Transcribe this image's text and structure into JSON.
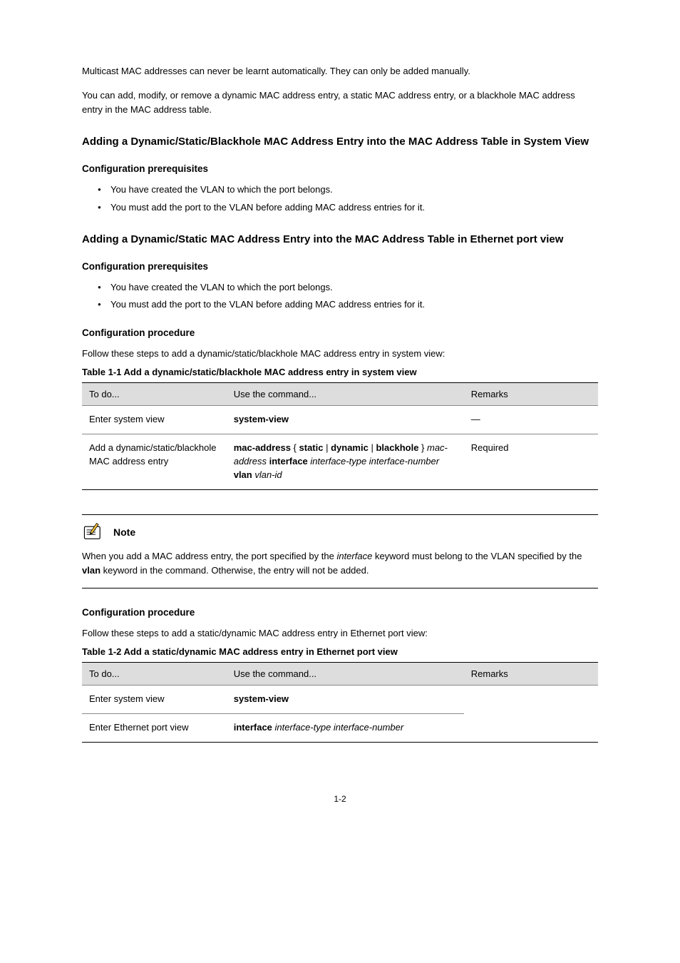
{
  "intro": {
    "p1": "Multicast MAC addresses can never be learnt automatically. They can only be added manually.",
    "p2": "You can add, modify, or remove a dynamic MAC address entry, a static MAC address entry, or a blackhole MAC address entry in the MAC address table."
  },
  "sec1": {
    "heading": "Adding a Dynamic/Static/Blackhole MAC Address Entry into the MAC Address Table in System View",
    "config_prereq_heading": "Configuration prerequisites",
    "prereq_bullets": [
      "You have created the VLAN to which the port belongs.",
      "You must add the port to the VLAN before adding MAC address entries for it."
    ],
    "config_proc_heading": "Configuration procedure",
    "config_proc_para": "Follow these steps to add a dynamic/static/blackhole MAC address entry in system view:"
  },
  "sec2": {
    "heading": "Adding a Dynamic/Static MAC Address Entry into the MAC Address Table in Ethernet port view",
    "config_prereq_heading": "Configuration prerequisites",
    "prereq_bullets": [
      "You have created the VLAN to which the port belongs.",
      "You must add the port to the VLAN before adding MAC address entries for it."
    ],
    "config_proc_heading": "Configuration procedure",
    "config_proc_para": "Follow these steps to add a static/dynamic MAC address entry in Ethernet port view:"
  },
  "table1": {
    "caption": "Table 1-1 Add a dynamic/static/blackhole MAC address entry in system view",
    "headers": {
      "todo": "To do...",
      "cmd": "Use the command...",
      "rem": "Remarks"
    },
    "rows": [
      {
        "todo": "Enter system view",
        "cmd": "system-view",
        "rem": "—"
      },
      {
        "todo": "Add a dynamic/static/blackhole MAC address entry",
        "cmd_html": "<b>mac-address</b> { <b>static</b> | <b>dynamic</b> | <b>blackhole</b> } <i>mac-address</i> <b>interface</b> <i>interface-type interface-number</i> <b>vlan</b> <i>vlan-id</i>",
        "rem": "Required"
      }
    ]
  },
  "note": {
    "label": "Note",
    "body_html": "When you add a MAC address entry, the port specified by the <i>interface</i> keyword must belong to the VLAN specified by the <b>vlan</b> keyword in the command. Otherwise, the entry will not be added."
  },
  "table2": {
    "caption": "Table 1-2 Add a static/dynamic MAC address entry in Ethernet port view",
    "headers": {
      "todo": "To do...",
      "cmd": "Use the command...",
      "rem": "Remarks"
    },
    "rows": [
      {
        "todo": "Enter system view",
        "cmd": "system-view",
        "rem": ""
      },
      {
        "todo": "Enter Ethernet port view",
        "cmd_html": "<b>interface</b> <i>interface-type interface-number</i>",
        "rem": "—"
      }
    ]
  },
  "footer": {
    "page_number": "1-2"
  }
}
